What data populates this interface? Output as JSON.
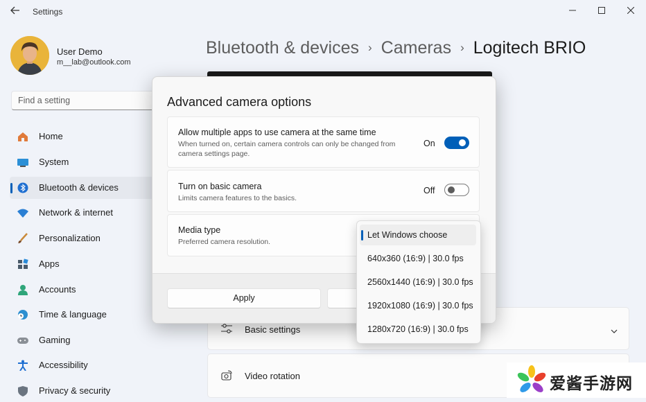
{
  "window": {
    "app_title": "Settings",
    "back_icon": "back-arrow-icon",
    "controls": [
      "minimize-icon",
      "maximize-icon",
      "close-icon"
    ]
  },
  "user": {
    "name": "User Demo",
    "email": "m__lab@outlook.com"
  },
  "search": {
    "placeholder": "Find a setting"
  },
  "sidebar": {
    "items": [
      {
        "label": "Home",
        "icon": "home-icon"
      },
      {
        "label": "System",
        "icon": "system-icon"
      },
      {
        "label": "Bluetooth & devices",
        "icon": "bluetooth-icon",
        "selected": true
      },
      {
        "label": "Network & internet",
        "icon": "wifi-icon"
      },
      {
        "label": "Personalization",
        "icon": "brush-icon"
      },
      {
        "label": "Apps",
        "icon": "apps-icon"
      },
      {
        "label": "Accounts",
        "icon": "accounts-icon"
      },
      {
        "label": "Time & language",
        "icon": "clock-globe-icon"
      },
      {
        "label": "Gaming",
        "icon": "gamepad-icon"
      },
      {
        "label": "Accessibility",
        "icon": "accessibility-icon"
      },
      {
        "label": "Privacy & security",
        "icon": "shield-icon"
      }
    ]
  },
  "breadcrumb": {
    "part1": "Bluetooth & devices",
    "part2": "Cameras",
    "current": "Logitech BRIO",
    "separator": "›"
  },
  "main": {
    "basic_settings_label": "Basic settings",
    "video_rotation_label": "Video rotation"
  },
  "dialog": {
    "title": "Advanced camera options",
    "options": [
      {
        "title": "Allow multiple apps to use camera at the same time",
        "desc": "When turned on, certain camera controls can only be changed from camera settings page.",
        "state": "On"
      },
      {
        "title": "Turn on basic camera",
        "desc": "Limits camera features to the basics.",
        "state": "Off"
      },
      {
        "title": "Media type",
        "desc": "Preferred camera resolution."
      }
    ],
    "apply_label": "Apply"
  },
  "media_dropdown": {
    "options": [
      "Let Windows choose",
      "640x360 (16:9) | 30.0 fps",
      "2560x1440 (16:9) | 30.0 fps",
      "1920x1080 (16:9) | 30.0 fps",
      "1280x720 (16:9) | 30.0 fps"
    ],
    "selected_index": 0
  },
  "watermark": {
    "text": "爱酱手游网"
  },
  "colors": {
    "accent": "#005fb8",
    "background": "#f0f3f9"
  }
}
